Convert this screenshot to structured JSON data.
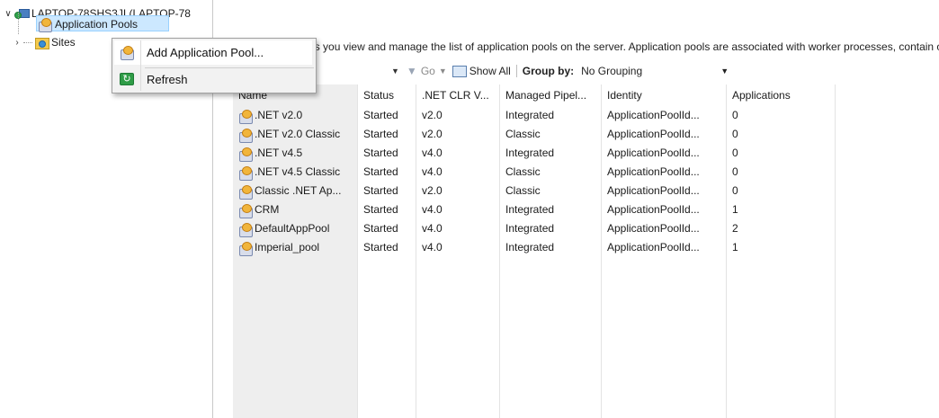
{
  "tree": {
    "server": "LAPTOP-78SHS3JI (LAPTOP-78",
    "app_pools": "Application Pools",
    "sites": "Sites"
  },
  "context_menu": {
    "add": "Add Application Pool...",
    "refresh": "Refresh"
  },
  "main": {
    "description": "This page lets you view and manage the list of application pools on the server. Application pools are associated with worker processes, contain one or more applications, and provide isolation among different applications.",
    "toolbar": {
      "go": "Go",
      "show_all": "Show All",
      "group_by_label": "Group by:",
      "group_by_value": "No Grouping"
    },
    "columns": [
      "Name",
      "Status",
      ".NET CLR V...",
      "Managed Pipel...",
      "Identity",
      "Applications"
    ],
    "rows": [
      {
        "name": ".NET v2.0",
        "status": "Started",
        "clr": "v2.0",
        "pipeline": "Integrated",
        "identity": "ApplicationPoolId...",
        "apps": "0"
      },
      {
        "name": ".NET v2.0 Classic",
        "status": "Started",
        "clr": "v2.0",
        "pipeline": "Classic",
        "identity": "ApplicationPoolId...",
        "apps": "0"
      },
      {
        "name": ".NET v4.5",
        "status": "Started",
        "clr": "v4.0",
        "pipeline": "Integrated",
        "identity": "ApplicationPoolId...",
        "apps": "0"
      },
      {
        "name": ".NET v4.5 Classic",
        "status": "Started",
        "clr": "v4.0",
        "pipeline": "Classic",
        "identity": "ApplicationPoolId...",
        "apps": "0"
      },
      {
        "name": "Classic .NET Ap...",
        "status": "Started",
        "clr": "v2.0",
        "pipeline": "Classic",
        "identity": "ApplicationPoolId...",
        "apps": "0"
      },
      {
        "name": "CRM",
        "status": "Started",
        "clr": "v4.0",
        "pipeline": "Integrated",
        "identity": "ApplicationPoolId...",
        "apps": "1"
      },
      {
        "name": "DefaultAppPool",
        "status": "Started",
        "clr": "v4.0",
        "pipeline": "Integrated",
        "identity": "ApplicationPoolId...",
        "apps": "2"
      },
      {
        "name": "Imperial_pool",
        "status": "Started",
        "clr": "v4.0",
        "pipeline": "Integrated",
        "identity": "ApplicationPoolId...",
        "apps": "1"
      }
    ]
  },
  "colors": {
    "selection": "#cce8ff",
    "name_column_bg": "#eeeeee",
    "menu_bg": "#f2f2f2"
  }
}
